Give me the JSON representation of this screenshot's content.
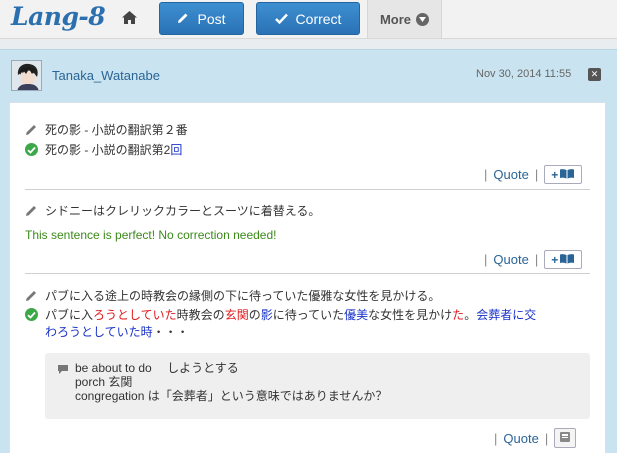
{
  "header": {
    "logo": "Lang-8",
    "post_label": "Post",
    "correct_label": "Correct",
    "more_label": "More"
  },
  "entry": {
    "username": "Tanaka_Watanabe",
    "date": "Nov 30, 2014 11:55",
    "close": "✕"
  },
  "corrections": {
    "c1": {
      "original": "死の影 - 小説の翻訳第２番",
      "corrected_a": "死の影 - 小説の翻訳第2",
      "corrected_b": "回"
    },
    "c2": {
      "original": "シドニーはクレリックカラーとスーツに着替える。",
      "perfect_msg": "This sentence is perfect! No correction needed!"
    },
    "c3": {
      "original": "パブに入る途上の時教会の縁側の下に待っていた優雅な女性を見かける。",
      "p1": "パブに入",
      "p2": "ろうとしていた",
      "p3": "時教会の",
      "p4": "玄関",
      "p5": "の",
      "p6": "影",
      "p7": "に待っていた",
      "p8": "優美",
      "p9": "な女性を見かけ",
      "p10": "た",
      "p11": "。",
      "p12": "会葬者に交",
      "p13": "わろうとしていた時",
      "p14": "・・・",
      "comment_l1": "be about to do　 しようとする",
      "comment_l2": "porch 玄関",
      "comment_l3": "congregation は「会葬者」という意味ではありませんか？"
    }
  },
  "actions": {
    "quote_label": "Quote",
    "separator": "|",
    "add_label": "+"
  },
  "icons": {
    "home": "home-icon",
    "post": "pencil-icon",
    "correct": "checkmark-icon",
    "more": "chevron-down-icon"
  },
  "colors": {
    "brand": "#2b6fae",
    "button": "#3383c6",
    "panel": "#c9e4f0",
    "correction_red": "#e0191c",
    "correction_blue": "#1a33c8",
    "ok_green": "#3ca84a"
  }
}
